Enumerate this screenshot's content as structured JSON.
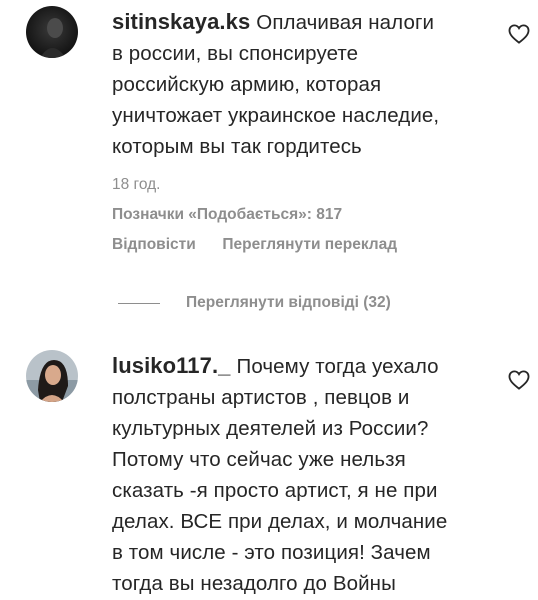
{
  "comments": [
    {
      "username": "sitinskaya.ks",
      "lines": [
        "Оплачивая налоги",
        "в россии, вы спонсируете",
        "российскую армию, которая",
        "уничтожает украинское наследие,",
        "которым вы так гордитесь"
      ],
      "time": "18 год.",
      "likes_label": "Позначки «Подобається»: 817",
      "reply_label": "Відповісти",
      "translate_label": "Переглянути переклад",
      "view_replies_label": "Переглянути відповіді (32)",
      "avatar_icon": "profile-photo",
      "like_icon": "heart-outline-icon"
    },
    {
      "username": "lusiko117._",
      "lines": [
        "Почему тогда уехало",
        "полстраны артистов , певцов и",
        "культурных деятелей из России?",
        "Потому что сейчас уже нельзя",
        "сказать -я просто артист, я не при",
        "делах. ВСЕ при делах, и молчание",
        "в том числе - это позиция! Зачем",
        "тогда вы незадолго до Войны"
      ],
      "avatar_icon": "profile-photo",
      "like_icon": "heart-outline-icon"
    }
  ],
  "colors": {
    "text": "#262626",
    "secondary": "#8e8e8e",
    "background": "#ffffff"
  }
}
